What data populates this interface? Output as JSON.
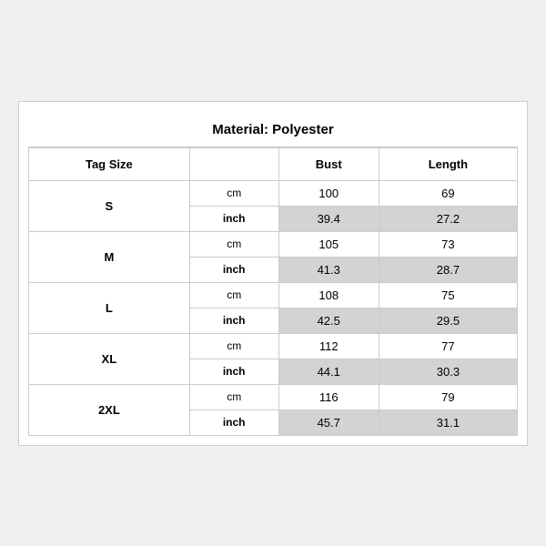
{
  "title": "Material: Polyester",
  "headers": {
    "tag_size": "Tag Size",
    "bust": "Bust",
    "length": "Length"
  },
  "sizes": [
    {
      "tag": "S",
      "rows": [
        {
          "unit": "cm",
          "bust": "100",
          "length": "69",
          "shaded": false
        },
        {
          "unit": "inch",
          "bust": "39.4",
          "length": "27.2",
          "shaded": true
        }
      ]
    },
    {
      "tag": "M",
      "rows": [
        {
          "unit": "cm",
          "bust": "105",
          "length": "73",
          "shaded": false
        },
        {
          "unit": "inch",
          "bust": "41.3",
          "length": "28.7",
          "shaded": true
        }
      ]
    },
    {
      "tag": "L",
      "rows": [
        {
          "unit": "cm",
          "bust": "108",
          "length": "75",
          "shaded": false
        },
        {
          "unit": "inch",
          "bust": "42.5",
          "length": "29.5",
          "shaded": true
        }
      ]
    },
    {
      "tag": "XL",
      "rows": [
        {
          "unit": "cm",
          "bust": "112",
          "length": "77",
          "shaded": false
        },
        {
          "unit": "inch",
          "bust": "44.1",
          "length": "30.3",
          "shaded": true
        }
      ]
    },
    {
      "tag": "2XL",
      "rows": [
        {
          "unit": "cm",
          "bust": "116",
          "length": "79",
          "shaded": false
        },
        {
          "unit": "inch",
          "bust": "45.7",
          "length": "31.1",
          "shaded": true
        }
      ]
    }
  ]
}
